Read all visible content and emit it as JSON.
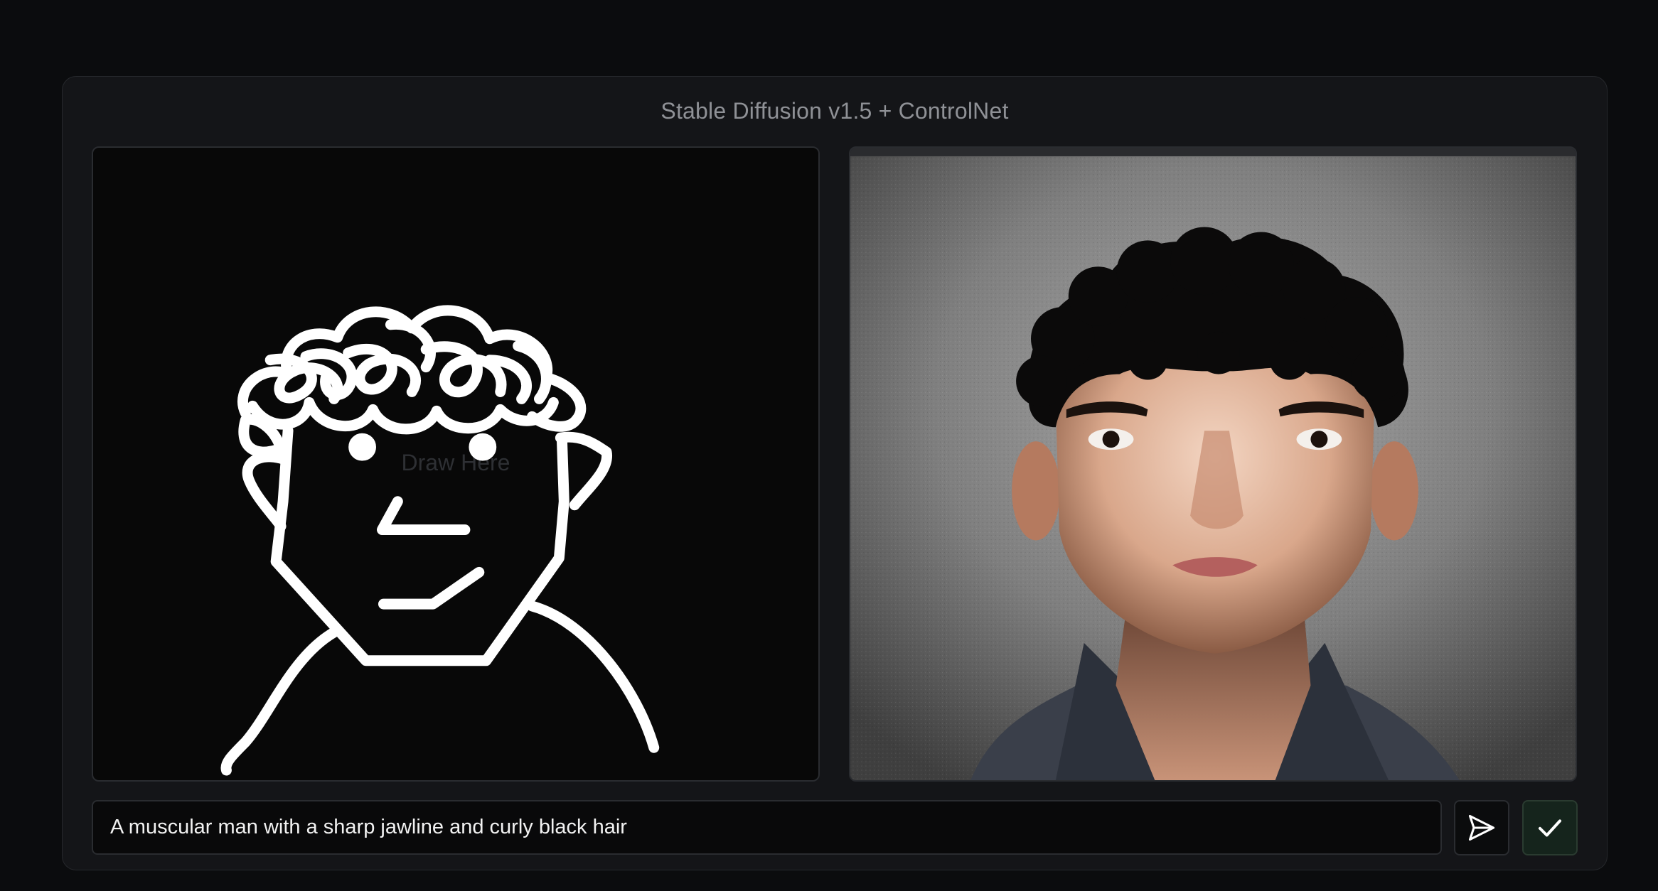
{
  "app": {
    "title": "Stable Diffusion v1.5 + ControlNet"
  },
  "canvas": {
    "placeholder": "Draw Here"
  },
  "prompt": {
    "value": "A muscular man with a sharp jawline and curly black hair"
  },
  "actions": {
    "send_icon": "send-icon",
    "confirm_icon": "check-icon"
  },
  "colors": {
    "background": "#0b0c0e",
    "card": "#141518",
    "sketch_stroke": "#ffffff",
    "confirm_accent": "#15241c"
  }
}
